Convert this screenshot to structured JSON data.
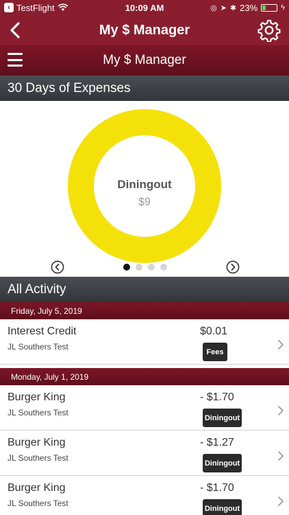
{
  "status_bar": {
    "carrier": "TestFlight",
    "time": "10:09 AM",
    "battery": "23%",
    "battery_level": 0.23,
    "battery_color": "#4cd964"
  },
  "nav": {
    "title": "My $ Manager"
  },
  "sub_header": {
    "title": "My $ Manager"
  },
  "expenses": {
    "title": "30 Days of Expenses",
    "center_category": "Diningout",
    "center_value": "$9",
    "ring_color": "#f5e10a",
    "page_count": 4,
    "active_page": 0
  },
  "activity": {
    "title": "All Activity",
    "groups": [
      {
        "date": "Friday, July 5, 2019",
        "items": [
          {
            "title": "Interest Credit",
            "account": "JL Southers Test",
            "amount": "$0.01",
            "category": "Fees"
          }
        ]
      },
      {
        "date": "Monday, July 1, 2019",
        "items": [
          {
            "title": "Burger King",
            "account": "JL Southers Test",
            "amount": "- $1.70",
            "category": "Diningout"
          },
          {
            "title": "Burger King",
            "account": "JL Southers Test",
            "amount": "- $1.27",
            "category": "Diningout"
          },
          {
            "title": "Burger King",
            "account": "JL Southers Test",
            "amount": "- $1.70",
            "category": "Diningout"
          }
        ]
      }
    ]
  },
  "colors": {
    "brand": "#8a1e2e",
    "section_header": "#3d4145",
    "badge": "#2b2b2b"
  },
  "icons": {
    "back": "chevron-left-icon",
    "settings": "gear-icon",
    "menu": "hamburger-icon",
    "prev": "circle-chevron-left-icon",
    "next": "circle-chevron-right-icon",
    "row_disclosure": "chevron-right-icon"
  }
}
